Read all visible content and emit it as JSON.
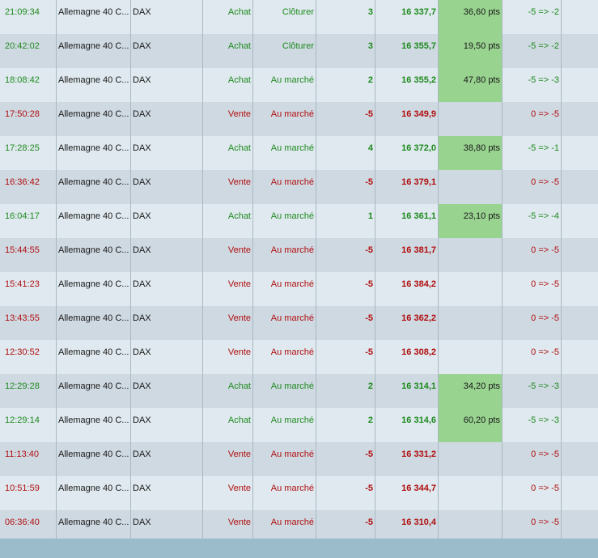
{
  "orders": [
    {
      "time": "21:09:34",
      "instrument": "Allemagne 40 C...",
      "symbol": "DAX",
      "direction": "Achat",
      "order_type": "Clôturer",
      "qty": "3",
      "price": "16 337,7",
      "pnl": "36,60 pts",
      "position": "-5 => -2",
      "side": "buy"
    },
    {
      "time": "20:42:02",
      "instrument": "Allemagne 40 C...",
      "symbol": "DAX",
      "direction": "Achat",
      "order_type": "Clôturer",
      "qty": "3",
      "price": "16 355,7",
      "pnl": "19,50 pts",
      "position": "-5 => -2",
      "side": "buy"
    },
    {
      "time": "18:08:42",
      "instrument": "Allemagne 40 C...",
      "symbol": "DAX",
      "direction": "Achat",
      "order_type": "Au marché",
      "qty": "2",
      "price": "16 355,2",
      "pnl": "47,80 pts",
      "position": "-5 => -3",
      "side": "buy"
    },
    {
      "time": "17:50:28",
      "instrument": "Allemagne 40 C...",
      "symbol": "DAX",
      "direction": "Vente",
      "order_type": "Au marché",
      "qty": "-5",
      "price": "16 349,9",
      "pnl": "",
      "position": "0 => -5",
      "side": "sell"
    },
    {
      "time": "17:28:25",
      "instrument": "Allemagne 40 C...",
      "symbol": "DAX",
      "direction": "Achat",
      "order_type": "Au marché",
      "qty": "4",
      "price": "16 372,0",
      "pnl": "38,80 pts",
      "position": "-5 => -1",
      "side": "buy"
    },
    {
      "time": "16:36:42",
      "instrument": "Allemagne 40 C...",
      "symbol": "DAX",
      "direction": "Vente",
      "order_type": "Au marché",
      "qty": "-5",
      "price": "16 379,1",
      "pnl": "",
      "position": "0 => -5",
      "side": "sell"
    },
    {
      "time": "16:04:17",
      "instrument": "Allemagne 40 C...",
      "symbol": "DAX",
      "direction": "Achat",
      "order_type": "Au marché",
      "qty": "1",
      "price": "16 361,1",
      "pnl": "23,10 pts",
      "position": "-5 => -4",
      "side": "buy"
    },
    {
      "time": "15:44:55",
      "instrument": "Allemagne 40 C...",
      "symbol": "DAX",
      "direction": "Vente",
      "order_type": "Au marché",
      "qty": "-5",
      "price": "16 381,7",
      "pnl": "",
      "position": "0 => -5",
      "side": "sell"
    },
    {
      "time": "15:41:23",
      "instrument": "Allemagne 40 C...",
      "symbol": "DAX",
      "direction": "Vente",
      "order_type": "Au marché",
      "qty": "-5",
      "price": "16 384,2",
      "pnl": "",
      "position": "0 => -5",
      "side": "sell"
    },
    {
      "time": "13:43:55",
      "instrument": "Allemagne 40 C...",
      "symbol": "DAX",
      "direction": "Vente",
      "order_type": "Au marché",
      "qty": "-5",
      "price": "16 362,2",
      "pnl": "",
      "position": "0 => -5",
      "side": "sell"
    },
    {
      "time": "12:30:52",
      "instrument": "Allemagne 40 C...",
      "symbol": "DAX",
      "direction": "Vente",
      "order_type": "Au marché",
      "qty": "-5",
      "price": "16 308,2",
      "pnl": "",
      "position": "0 => -5",
      "side": "sell"
    },
    {
      "time": "12:29:28",
      "instrument": "Allemagne 40 C...",
      "symbol": "DAX",
      "direction": "Achat",
      "order_type": "Au marché",
      "qty": "2",
      "price": "16 314,1",
      "pnl": "34,20 pts",
      "position": "-5 => -3",
      "side": "buy"
    },
    {
      "time": "12:29:14",
      "instrument": "Allemagne 40 C...",
      "symbol": "DAX",
      "direction": "Achat",
      "order_type": "Au marché",
      "qty": "2",
      "price": "16 314,6",
      "pnl": "60,20 pts",
      "position": "-5 => -3",
      "side": "buy"
    },
    {
      "time": "11:13:40",
      "instrument": "Allemagne 40 C...",
      "symbol": "DAX",
      "direction": "Vente",
      "order_type": "Au marché",
      "qty": "-5",
      "price": "16 331,2",
      "pnl": "",
      "position": "0 => -5",
      "side": "sell"
    },
    {
      "time": "10:51:59",
      "instrument": "Allemagne 40 C...",
      "symbol": "DAX",
      "direction": "Vente",
      "order_type": "Au marché",
      "qty": "-5",
      "price": "16 344,7",
      "pnl": "",
      "position": "0 => -5",
      "side": "sell"
    },
    {
      "time": "06:36:40",
      "instrument": "Allemagne 40 C...",
      "symbol": "DAX",
      "direction": "Vente",
      "order_type": "Au marché",
      "qty": "-5",
      "price": "16 310,4",
      "pnl": "",
      "position": "0 => -5",
      "side": "sell"
    }
  ],
  "colors": {
    "buy": "#1f8a1f",
    "sell": "#b01010",
    "pnl_fill": "#98d38f",
    "row_odd": "#dfe9ef",
    "row_even": "#cfd9e2"
  }
}
